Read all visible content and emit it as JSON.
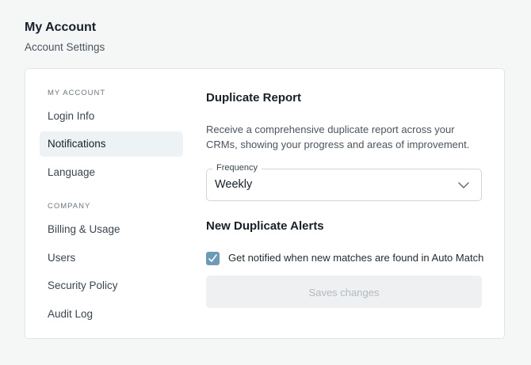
{
  "header": {
    "title": "My Account",
    "subtitle": "Account Settings"
  },
  "sidebar": {
    "sections": [
      {
        "label": "MY ACCOUNT",
        "items": [
          {
            "label": "Login Info",
            "active": false
          },
          {
            "label": "Notifications",
            "active": true
          },
          {
            "label": "Language",
            "active": false
          }
        ]
      },
      {
        "label": "COMPANY",
        "items": [
          {
            "label": "Billing & Usage",
            "active": false
          },
          {
            "label": "Users",
            "active": false
          },
          {
            "label": "Security Policy",
            "active": false
          },
          {
            "label": "Audit Log",
            "active": false
          }
        ]
      }
    ]
  },
  "main": {
    "duplicate_report": {
      "heading": "Duplicate Report",
      "description": "Receive a comprehensive duplicate report across your CRMs, showing your progress and areas of improvement.",
      "frequency_label": "Frequency",
      "frequency_value": "Weekly"
    },
    "alerts": {
      "heading": "New Duplicate Alerts",
      "checkbox_label": "Get notified when new matches are found in Auto Match",
      "checked": true
    },
    "save_label": "Saves changes"
  },
  "colors": {
    "accent_checkbox": "#6a9bb8",
    "active_nav_bg": "#edf2f4",
    "disabled_button_bg": "#eef0f1"
  },
  "icons": {
    "select": "chevron-down-icon",
    "checkbox": "checkmark-icon"
  }
}
